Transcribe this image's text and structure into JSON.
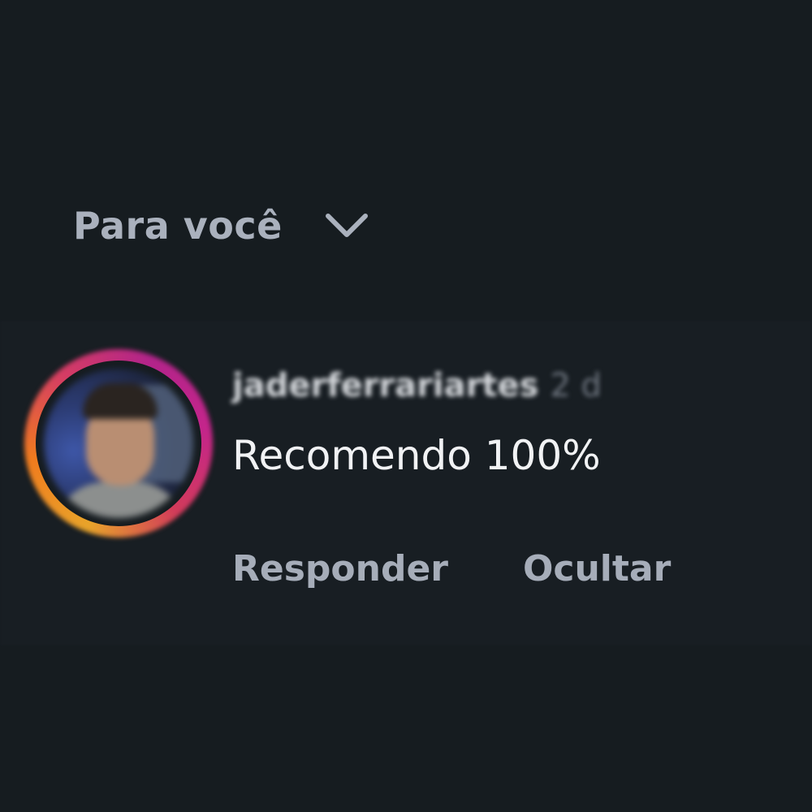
{
  "filter": {
    "label": "Para você",
    "icon": "chevron-down-icon"
  },
  "comment": {
    "username": "jaderferrariartes",
    "timestamp": "2 d",
    "text": "Recomendo 100%",
    "actions": {
      "reply_label": "Responder",
      "hide_label": "Ocultar"
    }
  },
  "colors": {
    "background": "#161c20",
    "primary_text": "#f1f2f4",
    "secondary_text": "#a6adb9",
    "story_ring": [
      "#e8a42a",
      "#d63d63",
      "#b2248a"
    ]
  }
}
